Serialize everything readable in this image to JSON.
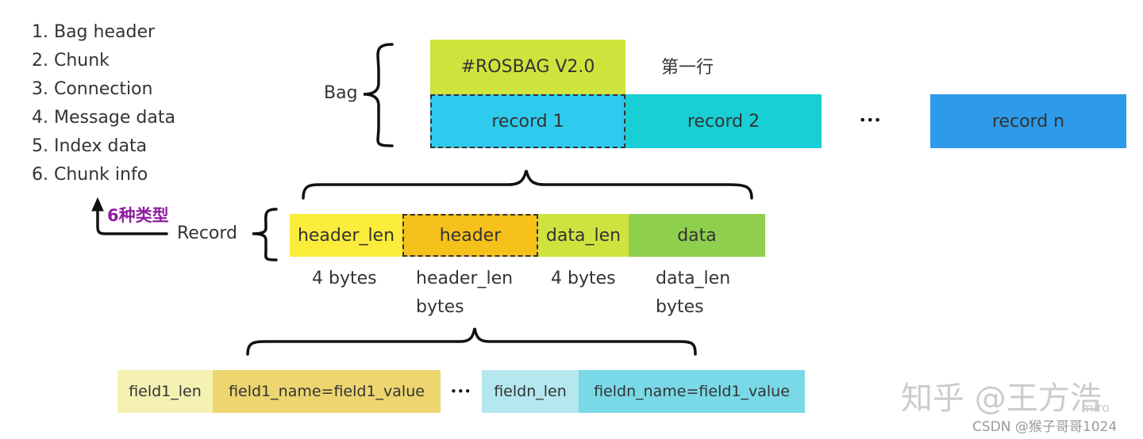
{
  "types_list": [
    "1. Bag header",
    "2. Chunk",
    "3. Connection",
    "4. Message data",
    "5. Index data",
    "6. Chunk info"
  ],
  "types_annotation": "6种类型",
  "bag": {
    "label": "Bag",
    "header_box": "#ROSBAG V2.0",
    "header_note": "第一行",
    "records": [
      "record 1",
      "record 2",
      "record n"
    ],
    "ellipsis": "•••"
  },
  "record": {
    "label": "Record",
    "fields": [
      {
        "name": "header_len",
        "size_line1": "4 bytes",
        "size_line2": ""
      },
      {
        "name": "header",
        "size_line1": "header_len",
        "size_line2": "bytes"
      },
      {
        "name": "data_len",
        "size_line1": "4 bytes",
        "size_line2": ""
      },
      {
        "name": "data",
        "size_line1": "data_len",
        "size_line2": "bytes"
      }
    ]
  },
  "header_fields": {
    "items": [
      "field1_len",
      "field1_name=field1_value",
      "fieldn_len",
      "fieldn_name=field1_value"
    ],
    "ellipsis": "•••"
  },
  "watermarks": {
    "zhihu": "知乎 @王方浩",
    "miro": "miro",
    "csdn": "CSDN @猴子哥哥1024"
  },
  "colors": {
    "rosbag": "#cfe33d",
    "record1": "#2ecbee",
    "record2": "#17cfd4",
    "recordn": "#2d9bea",
    "header_len": "#fbec3b",
    "header": "#f6c11a",
    "data_len": "#cfe33f",
    "data": "#8fcf4e",
    "field1_len": "#f5f1b2",
    "field1_name": "#edd570",
    "fieldn_len": "#b5e7ef",
    "fieldn_name": "#7ad9e7",
    "annotation": "#8e1ea0"
  }
}
